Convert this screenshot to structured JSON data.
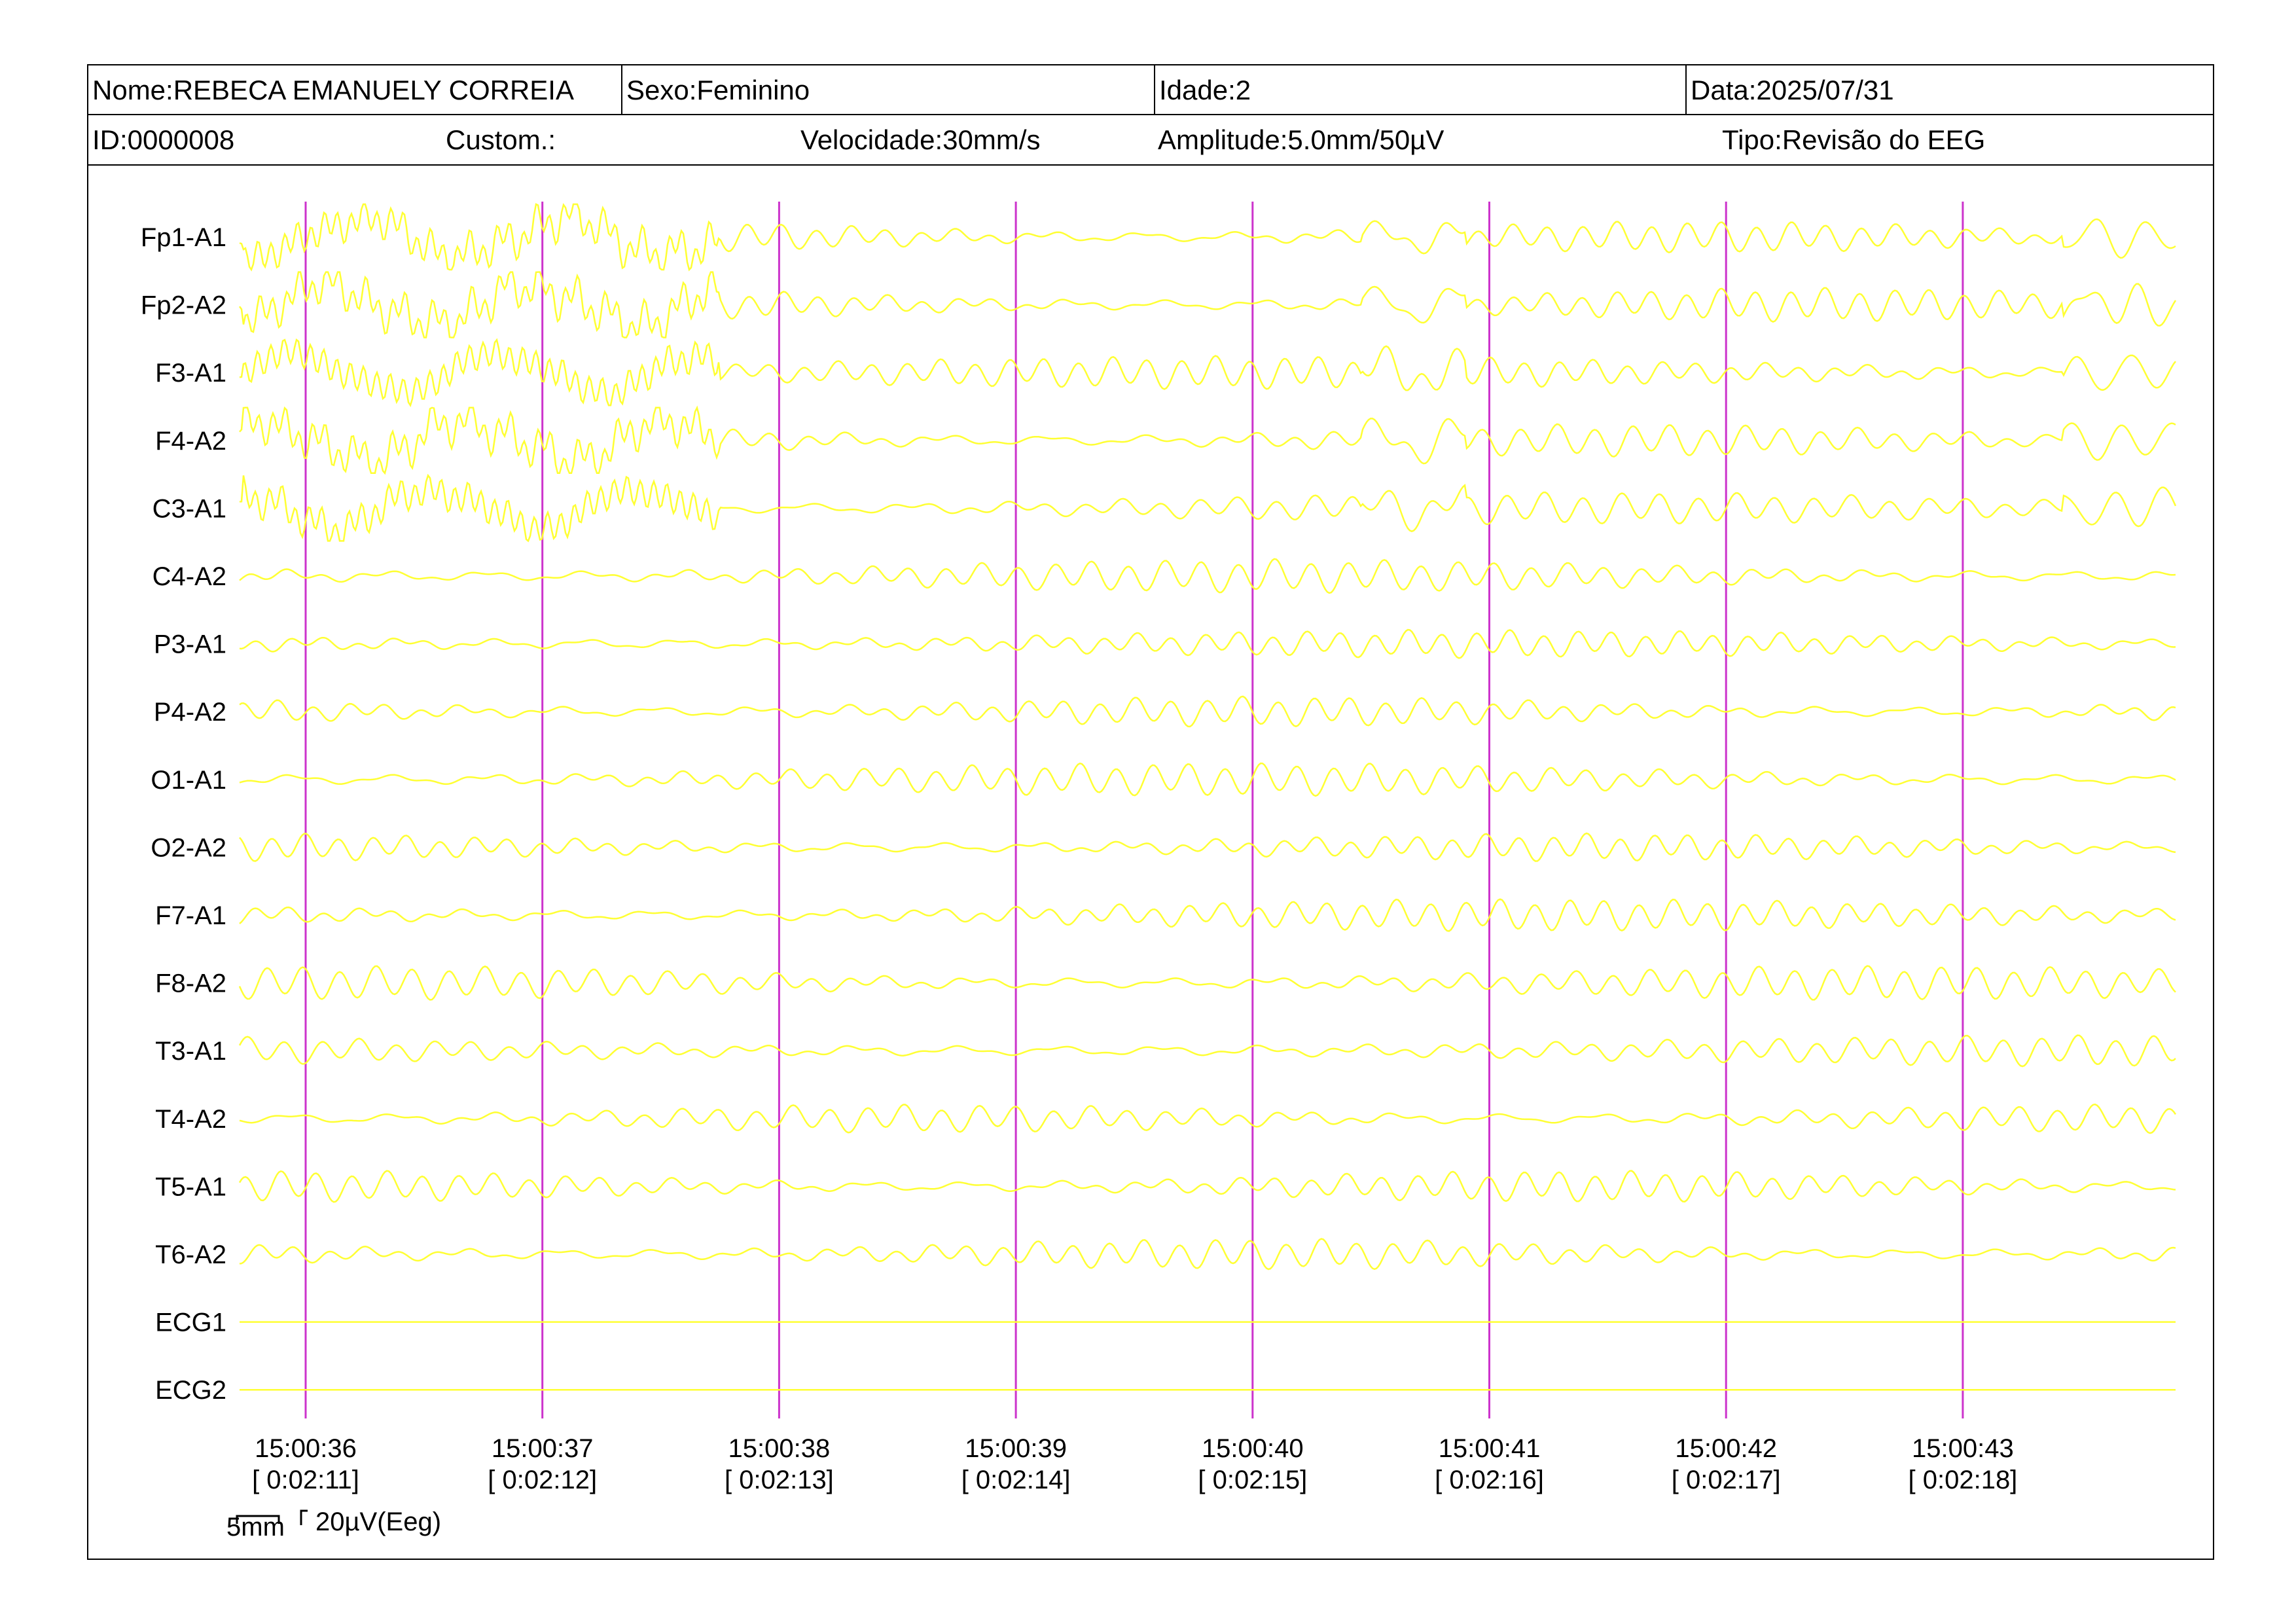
{
  "header": {
    "name": "Nome:REBECA EMANUELY CORREIA",
    "sex": "Sexo:Feminino",
    "age": "Idade:2",
    "date": "Data:2025/07/31",
    "id": "ID:0000008",
    "custom": "Custom.:",
    "speed": "Velocidade:30mm/s",
    "amplitude": "Amplitude:5.0mm/50µV",
    "type": "Tipo:Revisão do EEG"
  },
  "channels": [
    "Fp1-A1",
    "Fp2-A2",
    "F3-A1",
    "F4-A2",
    "C3-A1",
    "C4-A2",
    "P3-A1",
    "P4-A2",
    "O1-A1",
    "O2-A2",
    "F7-A1",
    "F8-A2",
    "T3-A1",
    "T4-A2",
    "T5-A1",
    "T6-A2",
    "ECG1",
    "ECG2"
  ],
  "time_markers": [
    {
      "time": "15:00:36",
      "elapsed": "[ 0:02:11]"
    },
    {
      "time": "15:00:37",
      "elapsed": "[ 0:02:12]"
    },
    {
      "time": "15:00:38",
      "elapsed": "[ 0:02:13]"
    },
    {
      "time": "15:00:39",
      "elapsed": "[ 0:02:14]"
    },
    {
      "time": "15:00:40",
      "elapsed": "[ 0:02:15]"
    },
    {
      "time": "15:00:41",
      "elapsed": "[ 0:02:16]"
    },
    {
      "time": "15:00:42",
      "elapsed": "[ 0:02:17]"
    },
    {
      "time": "15:00:43",
      "elapsed": "[ 0:02:18]"
    }
  ],
  "scale": {
    "time_label": "5mm",
    "amp_label": "20µV(Eeg)"
  },
  "colors": {
    "trace": "#ffff33",
    "marker": "#cc33cc",
    "border": "#000000"
  }
}
